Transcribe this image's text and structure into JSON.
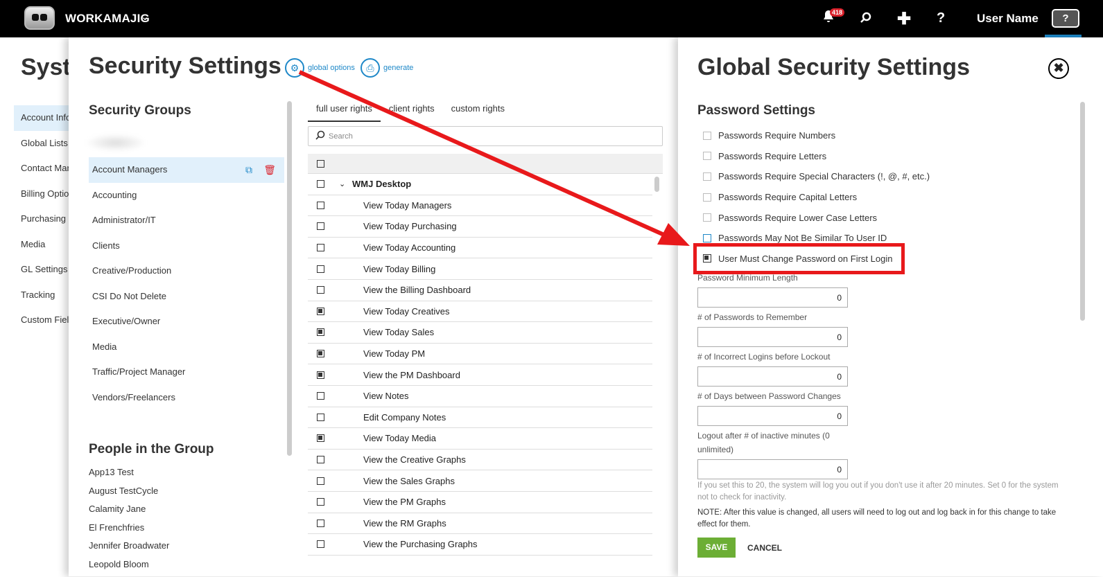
{
  "topbar": {
    "brand": "WORKAMAJIG",
    "notification_count": "418",
    "user_name": "User Name",
    "help_label": "?",
    "icons": [
      "app-logo-icon",
      "chevron-down-icon",
      "bell-icon",
      "search-icon",
      "plus-icon",
      "question-icon",
      "help-box-icon"
    ]
  },
  "system": {
    "title": "Syste",
    "nav": [
      "Account Info",
      "Global Lists",
      "Contact Man",
      "Billing Options",
      "Purchasing",
      "Media",
      "GL Settings",
      "Tracking",
      "Custom Field"
    ]
  },
  "security": {
    "title": "Security Settings",
    "global_options": "global options",
    "generate": "generate",
    "groups_heading": "Security Groups",
    "groups": [
      "Account Managers",
      "Accounting",
      "Administrator/IT",
      "Clients",
      "Creative/Production",
      "CSI Do Not Delete",
      "Executive/Owner",
      "Media",
      "Traffic/Project Manager",
      "Vendors/Freelancers"
    ],
    "people_heading": "People in the Group",
    "people": [
      "App13 Test",
      "August TestCycle",
      "Calamity Jane",
      "El Frenchfries",
      "Jennifer Broadwater",
      "Leopold Bloom"
    ],
    "tabs": [
      "full user rights",
      "client rights",
      "custom rights"
    ],
    "search_placeholder": "Search",
    "group_row": "WMJ Desktop",
    "rights": [
      {
        "label": "View Today Managers",
        "checked": false
      },
      {
        "label": "View Today Purchasing",
        "checked": false
      },
      {
        "label": "View Today Accounting",
        "checked": false
      },
      {
        "label": "View Today Billing",
        "checked": false
      },
      {
        "label": "View the Billing Dashboard",
        "checked": false
      },
      {
        "label": "View Today Creatives",
        "checked": true
      },
      {
        "label": "View Today Sales",
        "checked": true
      },
      {
        "label": "View Today PM",
        "checked": true
      },
      {
        "label": "View the PM Dashboard",
        "checked": true
      },
      {
        "label": "View Notes",
        "checked": false
      },
      {
        "label": "Edit Company Notes",
        "checked": false
      },
      {
        "label": "View Today Media",
        "checked": true
      },
      {
        "label": "View the Creative Graphs",
        "checked": false
      },
      {
        "label": "View the Sales Graphs",
        "checked": false
      },
      {
        "label": "View the PM Graphs",
        "checked": false
      },
      {
        "label": "View the RM Graphs",
        "checked": false
      },
      {
        "label": "View the Purchasing Graphs",
        "checked": false
      }
    ]
  },
  "global": {
    "title": "Global Security Settings",
    "password_heading": "Password Settings",
    "password_options": [
      {
        "label": "Passwords Require Numbers",
        "checked": false
      },
      {
        "label": "Passwords Require Letters",
        "checked": false
      },
      {
        "label": "Passwords Require Special Characters (!, @, #, etc.)",
        "checked": false
      },
      {
        "label": "Passwords Require Capital Letters",
        "checked": false
      },
      {
        "label": "Passwords Require Lower Case Letters",
        "checked": false
      },
      {
        "label": "Passwords May Not Be Similar To User ID",
        "checked": false
      },
      {
        "label": "User Must Change Password on First Login",
        "checked": true
      }
    ],
    "min_length_label": "Password Minimum Length",
    "min_length": "0",
    "remember_label": "# of Passwords to Remember",
    "remember": "0",
    "lockout_label": "# of Incorrect Logins before Lockout",
    "lockout": "0",
    "days_label": "# of Days between Password Changes",
    "days": "0",
    "logout_label_1": "Logout after # of inactive minutes (0",
    "logout_label_2": "unlimited)",
    "logout": "0",
    "help_text": "If you set this to 20, the system will log you out if you don't use it after 20 minutes. Set 0 for the system not to check for inactivity.",
    "note_text": "NOTE: After this value is changed, all users will need to log out and log back in for this change to take effect for them.",
    "save": "SAVE",
    "cancel": "CANCEL"
  },
  "colors": {
    "accent": "#1e88c8",
    "save": "#6cae35",
    "annotation": "#e8191b",
    "badge": "#d9202a"
  }
}
